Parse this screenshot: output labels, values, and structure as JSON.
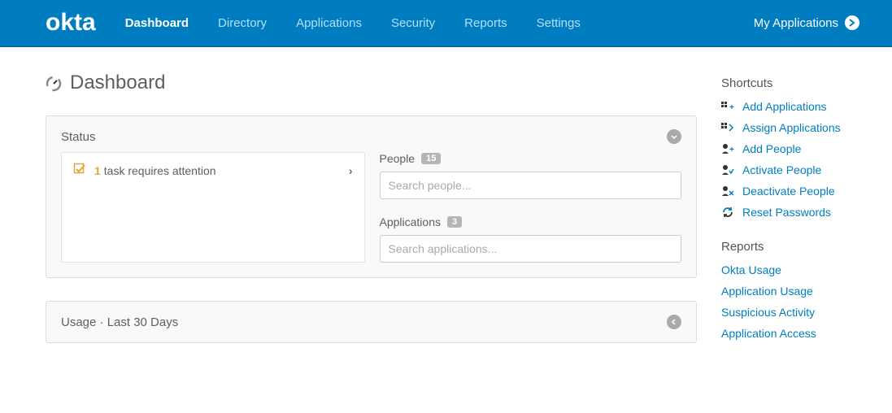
{
  "header": {
    "brand": "okta",
    "nav": [
      {
        "label": "Dashboard",
        "active": true
      },
      {
        "label": "Directory",
        "active": false
      },
      {
        "label": "Applications",
        "active": false
      },
      {
        "label": "Security",
        "active": false
      },
      {
        "label": "Reports",
        "active": false
      },
      {
        "label": "Settings",
        "active": false
      }
    ],
    "my_apps_label": "My Applications"
  },
  "page_title": "Dashboard",
  "status_panel": {
    "title": "Status",
    "task_count": "1",
    "task_text": "task requires attention",
    "people_label": "People",
    "people_count": "15",
    "people_placeholder": "Search people...",
    "apps_label": "Applications",
    "apps_count": "3",
    "apps_placeholder": "Search applications..."
  },
  "usage_panel": {
    "title": "Usage · Last 30 Days"
  },
  "sidebar": {
    "shortcuts_heading": "Shortcuts",
    "shortcuts": [
      {
        "label": "Add Applications"
      },
      {
        "label": "Assign Applications"
      },
      {
        "label": "Add People"
      },
      {
        "label": "Activate People"
      },
      {
        "label": "Deactivate People"
      },
      {
        "label": "Reset Passwords"
      }
    ],
    "reports_heading": "Reports",
    "reports": [
      {
        "label": "Okta Usage"
      },
      {
        "label": "Application Usage"
      },
      {
        "label": "Suspicious Activity"
      },
      {
        "label": "Application Access"
      }
    ]
  }
}
